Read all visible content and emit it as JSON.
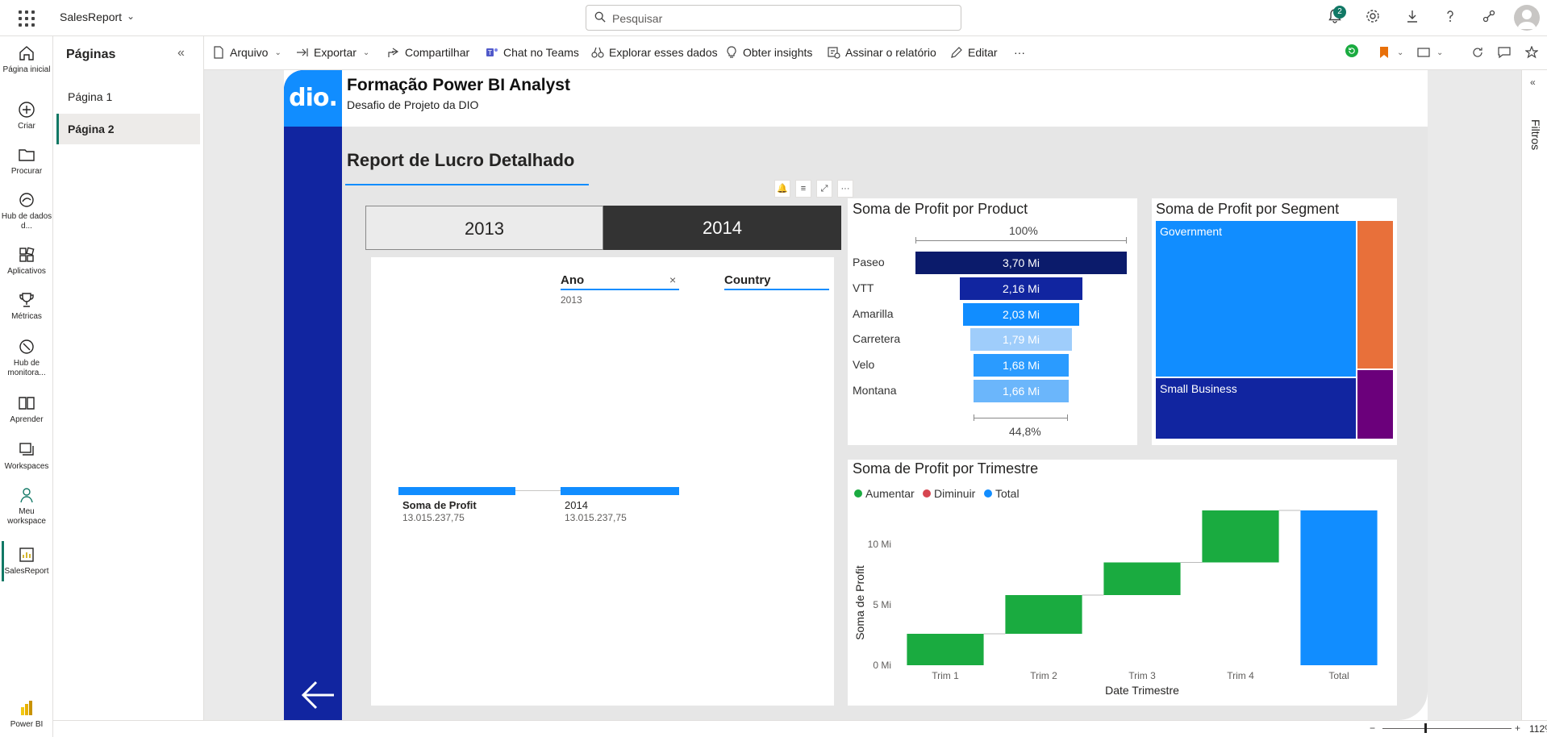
{
  "app": {
    "name": "SalesReport"
  },
  "search": {
    "placeholder": "Pesquisar"
  },
  "top_icons": [
    "bell-icon",
    "gear-icon",
    "download-icon",
    "help-icon",
    "share-icon"
  ],
  "notifications": {
    "count": "2"
  },
  "nav": {
    "items": [
      {
        "label": "Página inicial"
      },
      {
        "label": "Criar"
      },
      {
        "label": "Procurar"
      },
      {
        "label": "Hub de dados d..."
      },
      {
        "label": "Aplicativos"
      },
      {
        "label": "Métricas"
      },
      {
        "label": "Hub de monitora..."
      },
      {
        "label": "Aprender"
      },
      {
        "label": "Workspaces"
      },
      {
        "label": "Meu workspace"
      },
      {
        "label": "SalesReport"
      }
    ],
    "bottom_label": "Power BI"
  },
  "pages": {
    "title": "Páginas",
    "items": [
      {
        "label": "Página 1"
      },
      {
        "label": "Página 2"
      }
    ],
    "active": 1
  },
  "toolbar": {
    "arquivo": "Arquivo",
    "exportar": "Exportar",
    "compartilhar": "Compartilhar",
    "chat": "Chat no Teams",
    "explorar": "Explorar esses dados",
    "insights": "Obter insights",
    "assinar": "Assinar o relatório",
    "editar": "Editar",
    "more": "···"
  },
  "filters": {
    "label": "Filtros"
  },
  "status": {
    "zoom": "112%"
  },
  "report": {
    "logo": "dio.",
    "title": "Formação Power BI Analyst",
    "subtitle": "Desafio de Projeto da DIO",
    "section_title": "Report de Lucro Detalhado",
    "slicer": {
      "options": [
        "2013",
        "2014"
      ],
      "selected": "2014"
    },
    "decomp": {
      "level1_header": "Ano",
      "level1_filter": "2013",
      "level2_header": "Country",
      "root_name": "Soma de Profit",
      "root_value": "13.015.237,75",
      "node_name": "2014",
      "node_value": "13.015.237,75"
    },
    "funnel": {
      "title": "Soma de Profit por Product",
      "top_pct": "100%",
      "bottom_pct": "44,8%"
    },
    "treemap": {
      "title": "Soma de Profit por Segment"
    },
    "waterfall": {
      "title": "Soma de Profit por Trimestre",
      "legend": [
        {
          "label": "Aumentar",
          "color": "#1aab40"
        },
        {
          "label": "Diminuir",
          "color": "#d64550"
        },
        {
          "label": "Total",
          "color": "#118dff"
        }
      ]
    }
  },
  "chart_data": [
    {
      "type": "bar",
      "subtype": "funnel",
      "title": "Soma de Profit por Product",
      "categories": [
        "Paseo",
        "VTT",
        "Amarilla",
        "Carretera",
        "Velo",
        "Montana"
      ],
      "values": [
        3.7,
        2.16,
        2.03,
        1.79,
        1.68,
        1.66
      ],
      "value_labels": [
        "3,70 Mi",
        "2,16 Mi",
        "2,03 Mi",
        "1,79 Mi",
        "1,68 Mi",
        "1,66 Mi"
      ],
      "colors": [
        "#0b1b6b",
        "#1125a0",
        "#118dff",
        "#9fcdfb",
        "#2a9bff",
        "#6bb6fb"
      ]
    },
    {
      "type": "heatmap",
      "subtype": "treemap",
      "title": "Soma de Profit por Segment",
      "items": [
        {
          "name": "Government",
          "value": 11.4,
          "color": "#118dff"
        },
        {
          "name": "Small Business",
          "value": 4.5,
          "color": "#1125a0"
        },
        {
          "name": "",
          "value": 1.9,
          "color": "#e8703a"
        },
        {
          "name": "",
          "value": 0.9,
          "color": "#6b007b"
        }
      ]
    },
    {
      "type": "bar",
      "subtype": "waterfall",
      "title": "Soma de Profit por Trimestre",
      "xlabel": "Date Trimestre",
      "ylabel": "Soma de Profit",
      "categories": [
        "Trim 1",
        "Trim 2",
        "Trim 3",
        "Trim 4",
        "Total"
      ],
      "values": [
        2.6,
        3.2,
        2.7,
        4.3,
        12.8
      ],
      "kinds": [
        "increase",
        "increase",
        "increase",
        "increase",
        "total"
      ],
      "yticks": [
        0,
        5,
        10
      ],
      "ytick_labels": [
        "0 Mi",
        "5 Mi",
        "10 Mi"
      ],
      "ylim": [
        0,
        13
      ]
    }
  ]
}
